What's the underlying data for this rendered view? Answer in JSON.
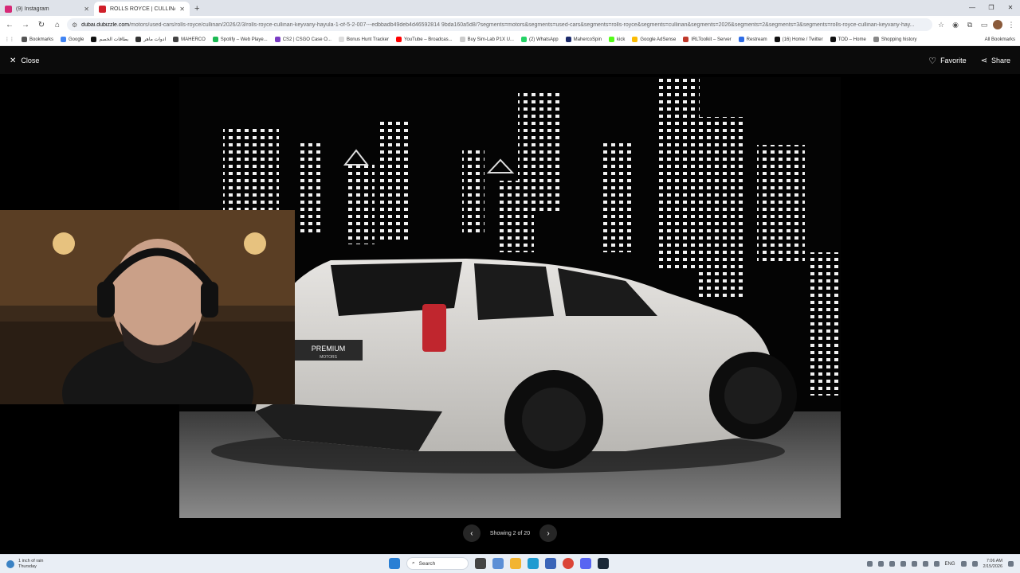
{
  "browser": {
    "tabs": [
      {
        "title": "(9) Instagram",
        "favicon_color": "#d62976"
      },
      {
        "title": "ROLLS ROYCE | CULLINAN KEY…",
        "favicon_color": "#d0202a"
      }
    ],
    "url_host": "dubai.dubizzle.com",
    "url_path": "/motors/used-cars/rolls-royce/cullinan/2026/2/3/rolls-royce-cullinan-keyvany-hayula-1-of-5-2-007---edbbadb49deb4d46592814 9bda160a5d8/?segments=motors&segments=used-cars&segments=rolls-royce&segments=cullinan&segments=2026&segments=2&segments=3&segments=rolls-royce-cullinan-keyvany-hay...",
    "bookmarks": [
      {
        "label": "Bookmarks",
        "color": "#555555"
      },
      {
        "label": "Google",
        "color": "#4285f4"
      },
      {
        "label": "بطاقات الخصم",
        "color": "#111111"
      },
      {
        "label": "ادوات ماهر",
        "color": "#333333"
      },
      {
        "label": "MAHERCO",
        "color": "#444444"
      },
      {
        "label": "Spotify – Web Playe...",
        "color": "#1db954"
      },
      {
        "label": "CS2 | CSGO Case O...",
        "color": "#7a3cc4"
      },
      {
        "label": "Bonus Hunt Tracker",
        "color": "#dddddd"
      },
      {
        "label": "YouTube – Broadcas...",
        "color": "#ff0000"
      },
      {
        "label": "Buy Sim-Lab P1X U...",
        "color": "#cccccc"
      },
      {
        "label": "(2) WhatsApp",
        "color": "#25d366"
      },
      {
        "label": "MahercoSpin",
        "color": "#1b2a6b"
      },
      {
        "label": "kick",
        "color": "#53fc18"
      },
      {
        "label": "Google AdSense",
        "color": "#fbbc04"
      },
      {
        "label": "IRLToolkit – Server",
        "color": "#c0392b"
      },
      {
        "label": "Restream",
        "color": "#2e6ce6"
      },
      {
        "label": "(16) Home / Twitter",
        "color": "#111111"
      },
      {
        "label": "TOD – Home",
        "color": "#111111"
      },
      {
        "label": "Shopping history",
        "color": "#888888"
      }
    ],
    "all_bookmarks": "All Bookmarks"
  },
  "viewer": {
    "close_label": "Close",
    "favorite_label": "Favorite",
    "share_label": "Share",
    "pager_text": "Showing 2 of 20",
    "plate_text": "PREMIUM",
    "plate_sub": "MOTORS",
    "car_color": "#d8d6d2"
  },
  "taskbar": {
    "weather_line1": "1 inch of rain",
    "weather_line2": "Thursday",
    "search_label": "Search",
    "lang": "ENG",
    "time": "7:06 AM",
    "date": "2/15/2026"
  }
}
